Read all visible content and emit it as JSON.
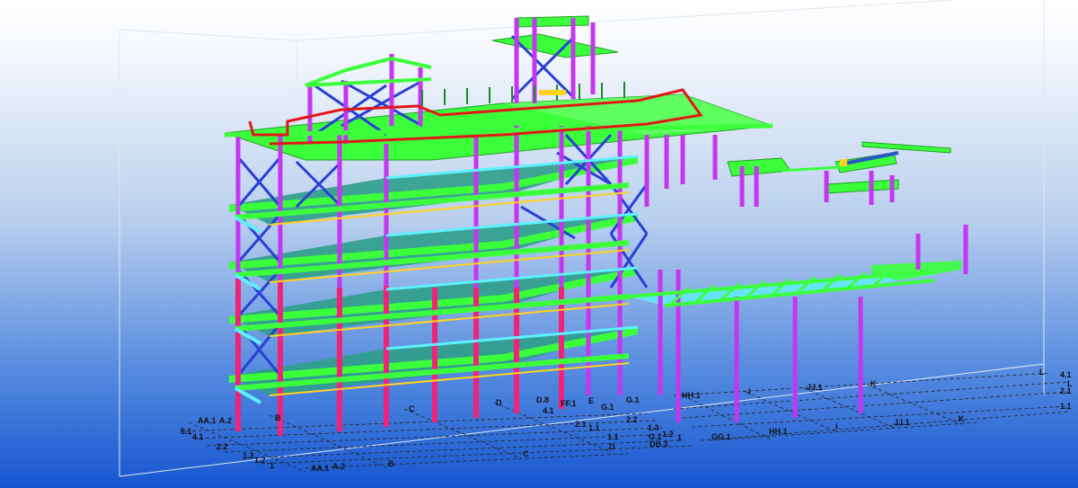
{
  "viewport": {
    "background_top": "#ffffff",
    "background_bottom": "#1656d0"
  },
  "colors": {
    "beam_green": "#3cff3c",
    "column_magenta": "#c436f0",
    "column_pink": "#f0237a",
    "brace_blue": "#2a3fd6",
    "handrail_red": "#e01818",
    "slab_teal": "#2f9e8a",
    "slab_cyan": "#5ef0ff",
    "plate_yellow": "#ffd21e",
    "grid_line": "#222222"
  },
  "grid_labels": {
    "left_block_top": [
      "AA.1",
      "A.2",
      "B",
      "C",
      "D",
      "D.8",
      "FF.1",
      "E",
      "G.1",
      "G.1",
      "4.1"
    ],
    "left_block_side": [
      "5.1",
      "4.1",
      "2.2",
      "1.3",
      "1.2",
      "1"
    ],
    "left_block_bottom": [
      "AA.1",
      "A.2",
      "B",
      "C",
      "D"
    ],
    "center_numbers": [
      "2.1",
      "2.2",
      "1.3",
      "1.2",
      "1.1",
      "1",
      "1.1"
    ],
    "right_top": [
      "HH.1",
      "I",
      "JJ.1",
      "K",
      "L"
    ],
    "right_bottom": [
      "GG.1",
      "HH.1",
      "I",
      "JJ.1",
      "K"
    ],
    "right_edge": [
      "4.1",
      "L",
      "2.1",
      "1.1"
    ],
    "bottom_misc": [
      "DB.3",
      "G.1"
    ]
  }
}
